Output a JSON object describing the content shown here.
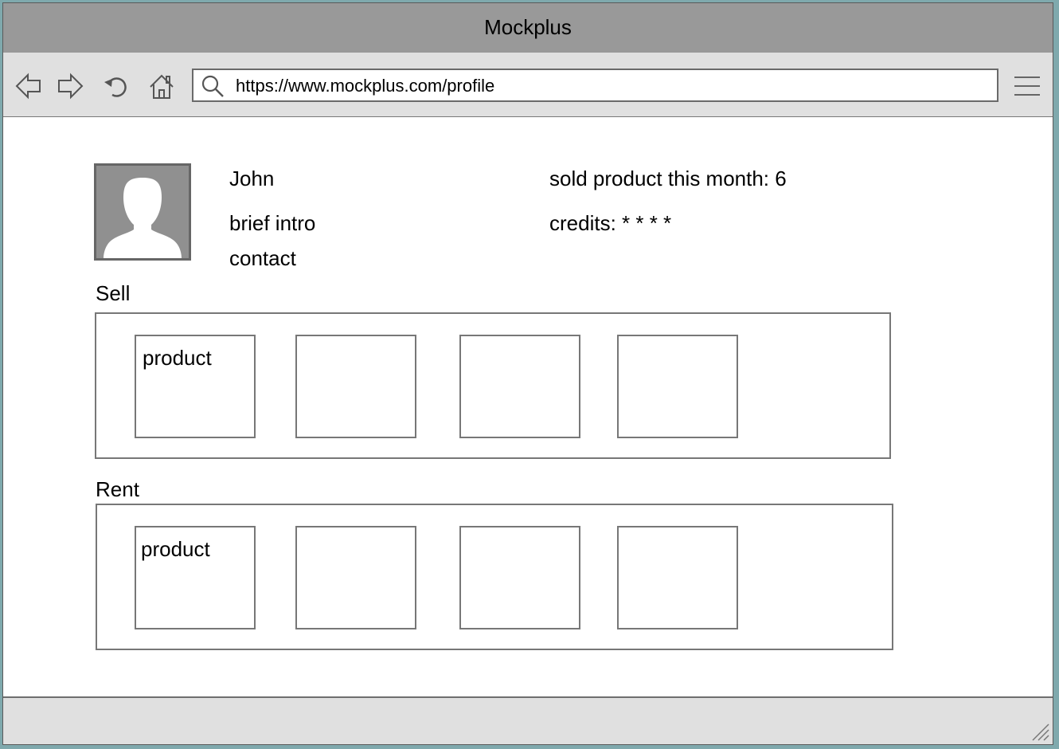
{
  "window": {
    "title": "Mockplus"
  },
  "toolbar": {
    "url": "https://www.mockplus.com/profile",
    "icons": [
      "back-arrow-icon",
      "forward-arrow-icon",
      "refresh-icon",
      "home-icon",
      "search-icon",
      "hamburger-menu-icon"
    ]
  },
  "profile": {
    "name": "John",
    "intro": "brief intro",
    "contact": "contact",
    "sold": "sold product this month: 6",
    "credits": "credits: * * * *"
  },
  "sell": {
    "heading": "Sell",
    "cards": [
      {
        "label": "product"
      },
      {
        "label": ""
      },
      {
        "label": ""
      },
      {
        "label": ""
      }
    ]
  },
  "rent": {
    "heading": "Rent",
    "cards": [
      {
        "label": "product"
      },
      {
        "label": ""
      },
      {
        "label": ""
      },
      {
        "label": ""
      }
    ]
  },
  "colors": {
    "titlebar": "#999999",
    "toolbar": "#e0e0e0",
    "frame": "#7fa9ad",
    "border": "#777777"
  }
}
